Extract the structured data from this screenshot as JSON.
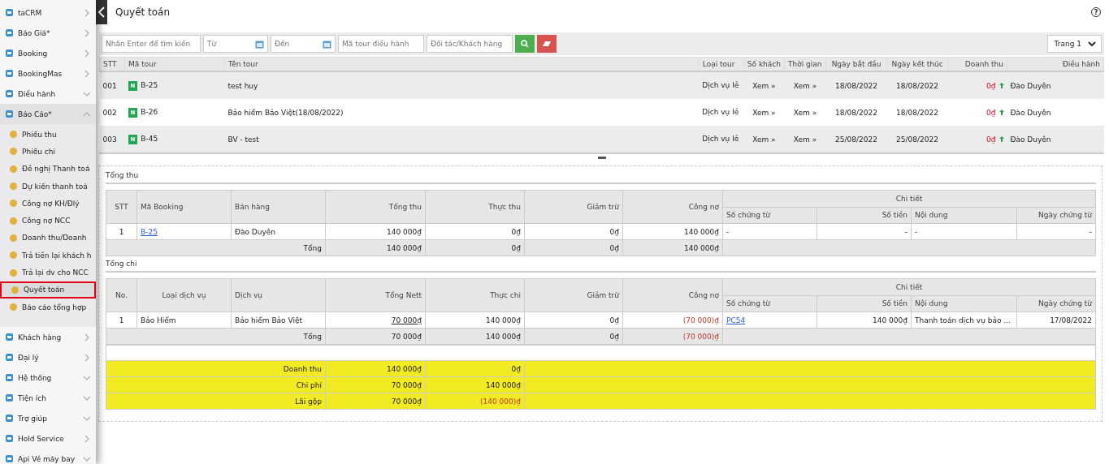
{
  "sidebar": {
    "items": [
      {
        "label": "taCRM",
        "kind": "link",
        "selected": false
      },
      {
        "label": "Báo Giá*",
        "kind": "link",
        "selected": false
      },
      {
        "label": "Booking",
        "kind": "link",
        "selected": false
      },
      {
        "label": "BookingMas",
        "kind": "link",
        "selected": false
      },
      {
        "label": "Điều hành",
        "kind": "group",
        "selected": false
      },
      {
        "label": "Báo Cáo*",
        "kind": "open",
        "selected": false,
        "children": [
          {
            "label": "Phiếu thu",
            "selected": false
          },
          {
            "label": "Phiếu chi",
            "selected": false
          },
          {
            "label": "Đề nghị Thanh toá",
            "selected": false
          },
          {
            "label": "Dự kiến thanh toá",
            "selected": false
          },
          {
            "label": "Công nợ KH/Đlý",
            "selected": false
          },
          {
            "label": "Công nợ NCC",
            "selected": false
          },
          {
            "label": "Doanh thu/Doanh",
            "selected": false
          },
          {
            "label": "Trả tiền lại khách h",
            "selected": false
          },
          {
            "label": "Trả lại dv cho NCC",
            "selected": false
          },
          {
            "label": "Quyết toán",
            "selected": true
          },
          {
            "label": "Báo cáo tổng hợp",
            "selected": false
          }
        ]
      },
      {
        "label": "Khách hàng",
        "kind": "link",
        "selected": false
      },
      {
        "label": "Đại lý",
        "kind": "link",
        "selected": false
      },
      {
        "label": "Hệ thống",
        "kind": "group",
        "selected": false
      },
      {
        "label": "Tiện ích",
        "kind": "group",
        "selected": false
      },
      {
        "label": "Trợ giúp",
        "kind": "group",
        "selected": false
      },
      {
        "label": "Hold Service",
        "kind": "link",
        "selected": false
      },
      {
        "label": "Api Vé máy bay",
        "kind": "group",
        "selected": false
      }
    ]
  },
  "header": {
    "title": "Quyết toán",
    "help": "?"
  },
  "filters": {
    "search": {
      "placeholder": "Nhấn Enter để tìm kiến"
    },
    "from": {
      "placeholder": "Từ"
    },
    "to": {
      "placeholder": "Đến"
    },
    "tour_code": {
      "placeholder": "Mã tour điều hành"
    },
    "partner": {
      "placeholder": "Đối tác/Khách hàng"
    },
    "page": "Trang 1"
  },
  "tours": {
    "columns": [
      "STT",
      "Mã tour",
      "Tên tour",
      "Loại tour",
      "Số khách",
      "Thời gian",
      "Ngày bắt đầu",
      "Ngày kết thúc",
      "Doanh thu",
      "Điều hành"
    ],
    "rows": [
      {
        "stt": "001",
        "badge": "N",
        "code": "B-25",
        "name": "test huy",
        "type": "Dịch vụ lẻ",
        "guests": "Xem »",
        "time": "Xem »",
        "start": "18/08/2022",
        "end": "18/08/2022",
        "revenue": "0₫",
        "operator": "Đào Duyên"
      },
      {
        "stt": "002",
        "badge": "N",
        "code": "B-26",
        "name": "Bảo hiểm Bảo Việt(18/08/2022)",
        "type": "Dịch vụ lẻ",
        "guests": "Xem »",
        "time": "Xem »",
        "start": "18/08/2022",
        "end": "18/08/2022",
        "revenue": "0₫",
        "operator": "Đào Duyên"
      },
      {
        "stt": "003",
        "badge": "N",
        "code": "B-45",
        "name": "BV - test",
        "type": "Dịch vụ lẻ",
        "guests": "Xem »",
        "time": "Xem »",
        "start": "25/08/2022",
        "end": "25/08/2022",
        "revenue": "0₫",
        "operator": "Đào Duyên"
      }
    ]
  },
  "income": {
    "title": "Tổng thu",
    "columns": [
      "STT",
      "Mã Booking",
      "Bán hàng",
      "Tổng thu",
      "Thực thu",
      "Giảm trừ",
      "Công nợ"
    ],
    "group": "Chi tiết",
    "sub_columns": [
      "Số chứng từ",
      "Số tiền",
      "Nội dung",
      "Ngày chứng từ"
    ],
    "rows": [
      [
        {
          "text": "1",
          "kind": "center"
        },
        {
          "text": "B-25",
          "kind": "link"
        },
        {
          "text": "Đào Duyên",
          "kind": "text"
        },
        {
          "text": "140 000₫",
          "kind": "money"
        },
        {
          "text": "0₫",
          "kind": "money"
        },
        {
          "text": "0₫",
          "kind": "money"
        },
        {
          "text": "140 000₫",
          "kind": "money"
        },
        {
          "text": "-",
          "kind": "text"
        },
        {
          "text": "-",
          "kind": "money"
        },
        {
          "text": "-",
          "kind": "text"
        },
        {
          "text": "-",
          "kind": "money"
        }
      ]
    ],
    "total": {
      "label": "Tổng",
      "cells": [
        {
          "text": "140 000₫",
          "kind": "money"
        },
        {
          "text": "0₫",
          "kind": "money"
        },
        {
          "text": "0₫",
          "kind": "money"
        },
        {
          "text": "140 000₫",
          "kind": "money"
        }
      ]
    }
  },
  "expense": {
    "title": "Tổng chi",
    "columns": [
      "No.",
      "Loại dịch vụ",
      "Dịch vụ",
      "Tổng Nett",
      "Thực chi",
      "Giảm trừ",
      "Công nợ"
    ],
    "group": "Chi tiết",
    "sub_columns": [
      "Số chứng từ",
      "Số tiền",
      "Nội dung",
      "Ngày chứng từ"
    ],
    "rows": [
      [
        {
          "text": "1",
          "kind": "center"
        },
        {
          "text": "Bảo Hiểm",
          "kind": "text"
        },
        {
          "text": "Bảo hiểm Bảo Việt",
          "kind": "text"
        },
        {
          "text": "70 000₫",
          "kind": "underlined"
        },
        {
          "text": "140 000₫",
          "kind": "money"
        },
        {
          "text": "0₫",
          "kind": "money"
        },
        {
          "text": "(70 000)₫",
          "kind": "negative"
        },
        {
          "text": "PC54",
          "kind": "link"
        },
        {
          "text": "140 000₫",
          "kind": "money"
        },
        {
          "text": "Thanh toán dịch vụ bảo ...",
          "kind": "text"
        },
        {
          "text": "17/08/2022",
          "kind": "money"
        }
      ]
    ],
    "total": {
      "label": "Tổng",
      "cells": [
        {
          "text": "70 000₫",
          "kind": "money"
        },
        {
          "text": "140 000₫",
          "kind": "money"
        },
        {
          "text": "0₫",
          "kind": "money"
        },
        {
          "text": "(70 000)₫",
          "kind": "negative"
        }
      ]
    }
  },
  "summary": [
    {
      "label": "Doanh thu",
      "cells": [
        {
          "text": "140 000₫",
          "kind": "money"
        },
        {
          "text": "0₫",
          "kind": "money"
        }
      ]
    },
    {
      "label": "Chi phí",
      "cells": [
        {
          "text": "70 000₫",
          "kind": "money"
        },
        {
          "text": "140 000₫",
          "kind": "money"
        }
      ]
    },
    {
      "label": "Lãi gộp",
      "cells": [
        {
          "text": "70 000₫",
          "kind": "money"
        },
        {
          "text": "(140 000)₫",
          "kind": "negative"
        }
      ]
    }
  ]
}
